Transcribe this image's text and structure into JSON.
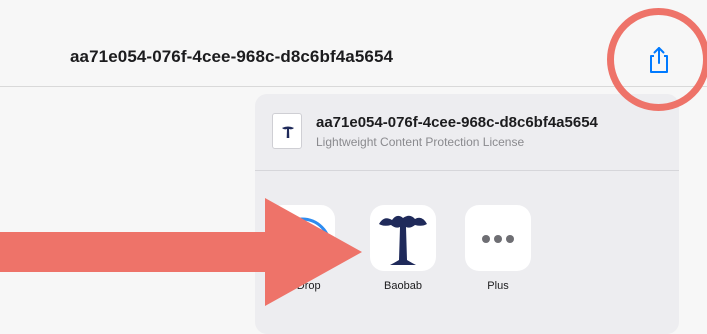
{
  "toolbar": {
    "title": "aa71e054-076f-4cee-968c-d8c6bf4a5654",
    "share_icon": "share-icon"
  },
  "share_sheet": {
    "file": {
      "name": "aa71e054-076f-4cee-968c-d8c6bf4a5654",
      "subtitle": "Lightweight Content Protection License",
      "thumb_icon": "baobab-tree-icon"
    },
    "apps": [
      {
        "label": "AirDrop",
        "icon": "airdrop-icon"
      },
      {
        "label": "Baobab",
        "icon": "baobab-tree-icon"
      },
      {
        "label": "Plus",
        "icon": "more-dots-icon"
      }
    ]
  },
  "annotations": {
    "color": "#ee7369",
    "circle_target": "share-button",
    "arrow_target": "Baobab"
  },
  "colors": {
    "accent": "#007aff",
    "baobab_navy": "#1f2a5a",
    "annotation": "#ee7369"
  }
}
